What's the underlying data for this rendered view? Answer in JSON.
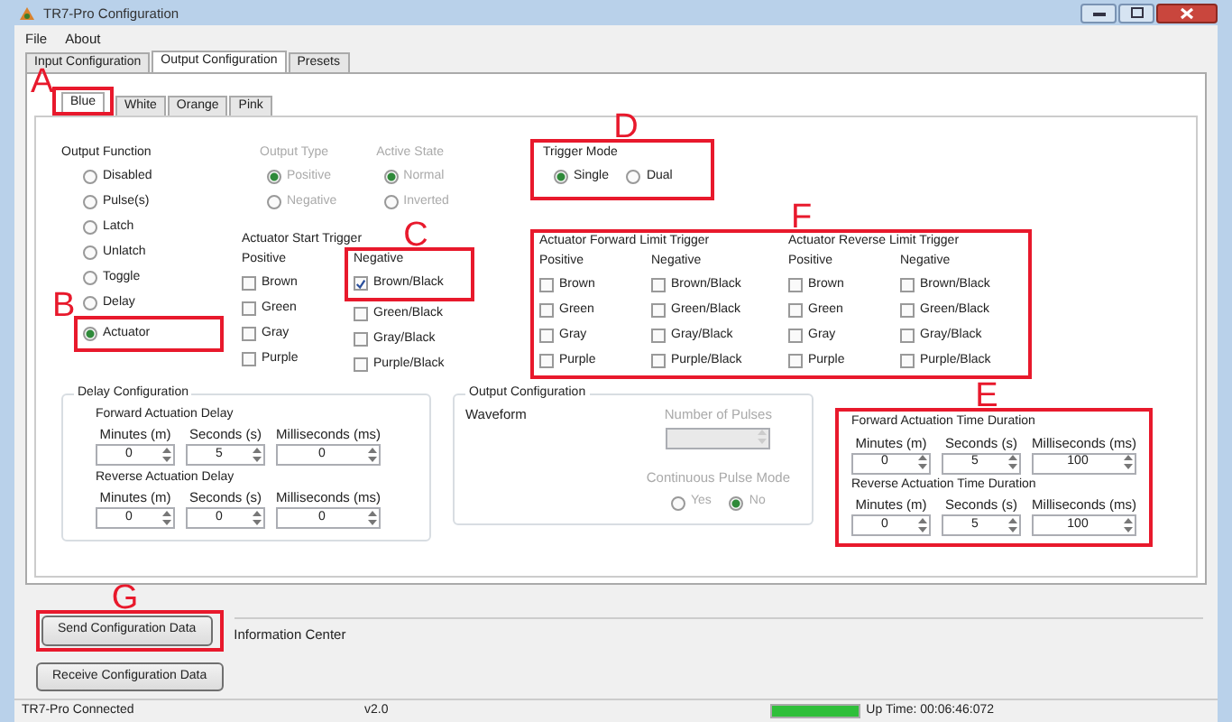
{
  "window": {
    "title": "TR7-Pro Configuration"
  },
  "menu": [
    "File",
    "About"
  ],
  "tabs": [
    {
      "label": "Input Configuration",
      "selected": false
    },
    {
      "label": "Output Configuration",
      "selected": true
    },
    {
      "label": "Presets",
      "selected": false
    }
  ],
  "subtabs": [
    {
      "label": "Blue",
      "selected": true,
      "annotation": "A"
    },
    {
      "label": "White",
      "selected": false
    },
    {
      "label": "Orange",
      "selected": false
    },
    {
      "label": "Pink",
      "selected": false
    }
  ],
  "output_function": {
    "title": "Output Function",
    "options": [
      {
        "label": "Disabled",
        "selected": false
      },
      {
        "label": "Pulse(s)",
        "selected": false
      },
      {
        "label": "Latch",
        "selected": false
      },
      {
        "label": "Unlatch",
        "selected": false
      },
      {
        "label": "Toggle",
        "selected": false
      },
      {
        "label": "Delay",
        "selected": false
      },
      {
        "label": "Actuator",
        "selected": true,
        "annotation": "B"
      }
    ]
  },
  "output_type": {
    "title": "Output Type",
    "disabled": true,
    "options": [
      {
        "label": "Positive",
        "selected": true
      },
      {
        "label": "Negative",
        "selected": false
      }
    ]
  },
  "active_state": {
    "title": "Active State",
    "disabled": true,
    "options": [
      {
        "label": "Normal",
        "selected": true
      },
      {
        "label": "Inverted",
        "selected": false
      }
    ]
  },
  "start_trigger": {
    "title": "Actuator Start Trigger",
    "columns": [
      {
        "heading": "Positive",
        "items": [
          {
            "label": "Brown",
            "checked": false
          },
          {
            "label": "Green",
            "checked": false
          },
          {
            "label": "Gray",
            "checked": false
          },
          {
            "label": "Purple",
            "checked": false
          }
        ]
      },
      {
        "heading": "Negative",
        "annotation": "C",
        "items": [
          {
            "label": "Brown/Black",
            "checked": true
          },
          {
            "label": "Green/Black",
            "checked": false
          },
          {
            "label": "Gray/Black",
            "checked": false
          },
          {
            "label": "Purple/Black",
            "checked": false
          }
        ]
      }
    ]
  },
  "trigger_mode": {
    "title": "Trigger Mode",
    "annotation": "D",
    "options": [
      {
        "label": "Single",
        "selected": true
      },
      {
        "label": "Dual",
        "selected": false
      }
    ]
  },
  "limit_triggers": {
    "annotation": "F",
    "groups": [
      {
        "title": "Actuator Forward Limit Trigger",
        "columns": [
          {
            "heading": "Positive",
            "items": [
              {
                "label": "Brown",
                "checked": false
              },
              {
                "label": "Green",
                "checked": false
              },
              {
                "label": "Gray",
                "checked": false
              },
              {
                "label": "Purple",
                "checked": false
              }
            ]
          },
          {
            "heading": "Negative",
            "items": [
              {
                "label": "Brown/Black",
                "checked": false
              },
              {
                "label": "Green/Black",
                "checked": false
              },
              {
                "label": "Gray/Black",
                "checked": false
              },
              {
                "label": "Purple/Black",
                "checked": false
              }
            ]
          }
        ]
      },
      {
        "title": "Actuator Reverse Limit Trigger",
        "columns": [
          {
            "heading": "Positive",
            "items": [
              {
                "label": "Brown",
                "checked": false
              },
              {
                "label": "Green",
                "checked": false
              },
              {
                "label": "Gray",
                "checked": false
              },
              {
                "label": "Purple",
                "checked": false
              }
            ]
          },
          {
            "heading": "Negative",
            "items": [
              {
                "label": "Brown/Black",
                "checked": false
              },
              {
                "label": "Green/Black",
                "checked": false
              },
              {
                "label": "Gray/Black",
                "checked": false
              },
              {
                "label": "Purple/Black",
                "checked": false
              }
            ]
          }
        ]
      }
    ]
  },
  "delay_configuration": {
    "title": "Delay Configuration",
    "groups": [
      {
        "title": "Forward Actuation Delay",
        "fields": [
          {
            "label": "Minutes (m)",
            "value": "0"
          },
          {
            "label": "Seconds (s)",
            "value": "5"
          },
          {
            "label": "Milliseconds (ms)",
            "value": "0"
          }
        ]
      },
      {
        "title": "Reverse Actuation Delay",
        "fields": [
          {
            "label": "Minutes (m)",
            "value": "0"
          },
          {
            "label": "Seconds (s)",
            "value": "0"
          },
          {
            "label": "Milliseconds (ms)",
            "value": "0"
          }
        ]
      }
    ]
  },
  "output_configuration": {
    "title": "Output Configuration",
    "waveform_label": "Waveform",
    "pulses": {
      "label": "Number of Pulses",
      "disabled": true
    },
    "continuous": {
      "title": "Continuous Pulse Mode",
      "disabled": true,
      "options": [
        {
          "label": "Yes",
          "selected": false
        },
        {
          "label": "No",
          "selected": true
        }
      ]
    }
  },
  "time_duration": {
    "annotation": "E",
    "groups": [
      {
        "title": "Forward Actuation Time Duration",
        "fields": [
          {
            "label": "Minutes (m)",
            "value": "0"
          },
          {
            "label": "Seconds (s)",
            "value": "5"
          },
          {
            "label": "Milliseconds (ms)",
            "value": "100"
          }
        ]
      },
      {
        "title": "Reverse Actuation Time Duration",
        "fields": [
          {
            "label": "Minutes (m)",
            "value": "0"
          },
          {
            "label": "Seconds (s)",
            "value": "5"
          },
          {
            "label": "Milliseconds (ms)",
            "value": "100"
          }
        ]
      }
    ]
  },
  "buttons": [
    {
      "label": "Send Configuration Data",
      "annotation": "G"
    },
    {
      "label": "Receive Configuration Data"
    }
  ],
  "information_center": {
    "label": "Information Center"
  },
  "status_bar": {
    "connection": "TR7-Pro Connected",
    "version": "v2.0",
    "uptime_meter": {
      "level": 1
    },
    "uptime": "Up Time: 00:06:46:072"
  }
}
